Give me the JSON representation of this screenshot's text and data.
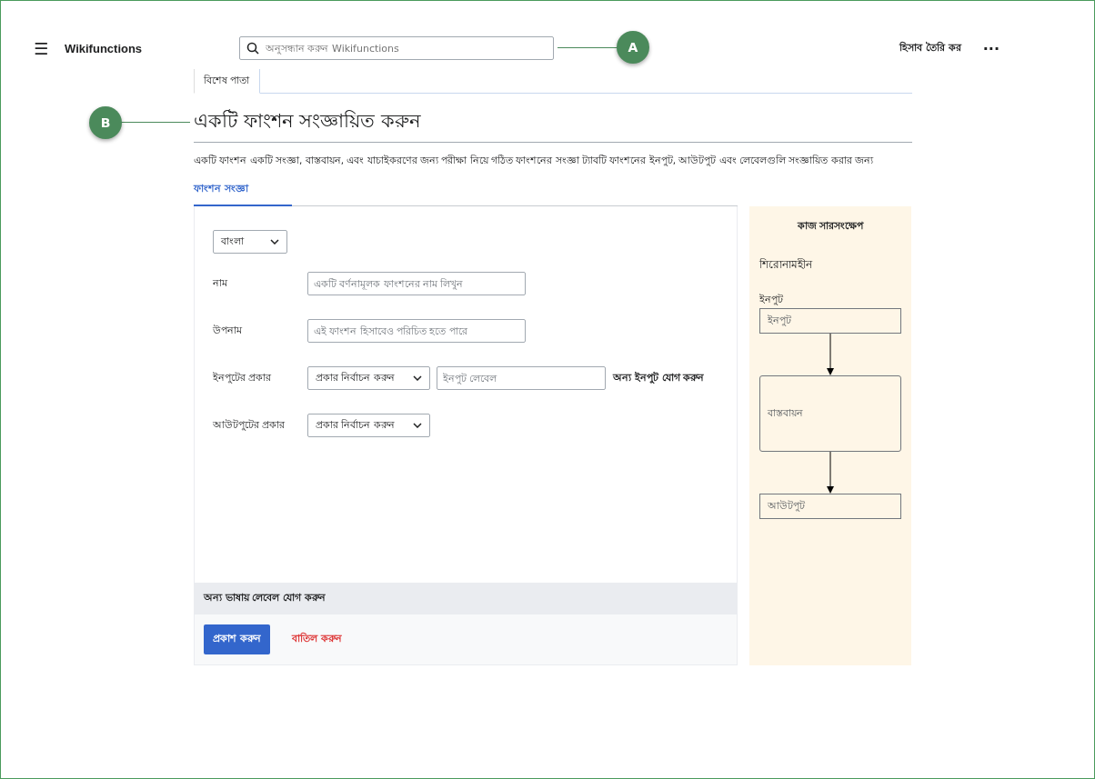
{
  "header": {
    "menu": "☰",
    "logo": "Wikifunctions",
    "search": {
      "placeholder": "অনুসন্ধান করুন Wikifunctions"
    },
    "create_account": "হিসাব তৈরি কর",
    "more": "···"
  },
  "callouts": [
    {
      "label": "A"
    },
    {
      "label": "B"
    }
  ],
  "tabs": [
    {
      "label": "বিশেষ পাতা",
      "selected": true
    }
  ],
  "title": "একটি ফাংশন সংজ্ঞায়িত করুন",
  "intro": "একটি ফাংশন একটি সংজ্ঞা, বাস্তবায়ন, এবং যাচাইকরণের জন্য পরীক্ষা নিয়ে গঠিত  ফাংশনের সংজ্ঞা ট্যাবটি ফাংশনের ইনপুট, আউটপুট এবং লেবেলগুলি সংজ্ঞায়িত করার জন্য",
  "form_tabs": [
    {
      "label": "ফাংশন সংজ্ঞা",
      "selected": true
    }
  ],
  "language": "বাংলা",
  "fields": [
    {
      "kind": "text",
      "label": "নাম",
      "placeholder": "একটি বর্ণনামূলক ফাংশনের নাম লিখুন"
    },
    {
      "kind": "text",
      "label": "উপনাম",
      "placeholder": "এই ফাংশন হিসাবেও পরিচিত হতে পারে"
    },
    {
      "kind": "input",
      "label": "ইনপুটের প্রকার",
      "select": "প্রকার নির্বাচন করুন",
      "placeholder": "ইনপুট লেবেল",
      "link": "অন্য ইনপুট যোগ করুন"
    },
    {
      "kind": "select",
      "label": "আউটপুটের প্রকার",
      "select": "প্রকার নির্বাচন করুন"
    }
  ],
  "other_languages": "অন্য ভাষায় লেবেল যোগ করুন",
  "buttons": [
    {
      "kind": "primary",
      "label": "প্রকাশ করুন"
    },
    {
      "kind": "cancel",
      "label": "বাতিল করুন"
    }
  ],
  "summary": {
    "title": "কাজ সারসংক্ষেপ",
    "name": "শিরোনামহীন",
    "inputs_label": "ইনপুট",
    "input": "ইনপুট",
    "implementation": "বাস্তবায়ন",
    "output": "আউটপুট"
  }
}
